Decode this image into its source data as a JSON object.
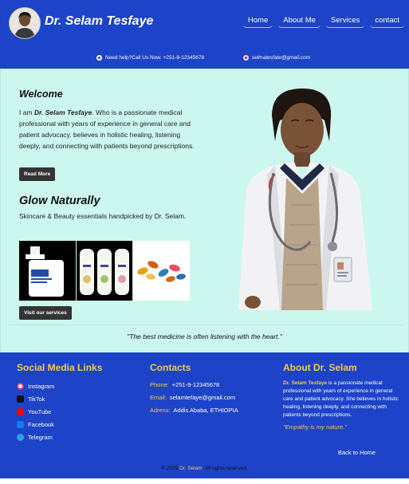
{
  "header": {
    "brand": "Dr. Selam Tesfaye",
    "nav": [
      "Home",
      "About Me",
      "Services",
      "contact"
    ],
    "help_text": "Need help?Call Us Now: +251-9-12345678",
    "email": "selmatesfate@gmail.com"
  },
  "welcome": {
    "title": "Welcome",
    "text_intro": "I am ",
    "text_name": "Dr. Selam Tesfaye",
    "text_rest": ". Who is a passionate medical professional with years of experience in general care and patient advocacy. believes in holistic healing, listening deeply, and connecting with patients beyond prescriptions.",
    "read_more": "Read More"
  },
  "glow": {
    "title": "Glow Naturally",
    "subtitle": "Skincare & Beauty essentials handpicked by Dr. Selam.",
    "button": "Visit our services"
  },
  "quote": "\"The best medicine is often listening with the heart.\"",
  "footer": {
    "social_title": "Social Media Links",
    "social": [
      {
        "label": "Instagram",
        "icon": "instagram-icon",
        "color": "#e1306c"
      },
      {
        "label": "TikTok",
        "icon": "tiktok-icon",
        "color": "#111111"
      },
      {
        "label": "YouTube",
        "icon": "youtube-icon",
        "color": "#ff0000"
      },
      {
        "label": "Facebook",
        "icon": "facebook-icon",
        "color": "#1877f2"
      },
      {
        "label": "Telegram",
        "icon": "telegram-icon",
        "color": "#2aa3e0"
      }
    ],
    "contacts_title": "Contacts",
    "phone_label": "Phone:",
    "phone": "+251-9-12345678",
    "email_label": "Email:",
    "email": "selamtefaye@gmail.com",
    "address_label": "Adress:",
    "address": "Addis Ababa, ETHIOPIA",
    "about_title": "About Dr. Selam",
    "about_name": "Dr. Selam Tesfaye",
    "about_text": " is a passionate medical professional with years of experience in general care and patient advocacy. She believes in holistic healing, listening deeply, and connecting with patients beyond prescriptions.",
    "motto": "\"Empathy is my nature.\"",
    "back_home": "Back to Home",
    "copyright_pre": "© 2025 ",
    "copyright_name": "Dr. Selam",
    "copyright_post": ". All rights reserved."
  },
  "colors": {
    "primary": "#1d43c9",
    "accent": "#f2c94c",
    "main_bg": "#cbf7ee"
  }
}
